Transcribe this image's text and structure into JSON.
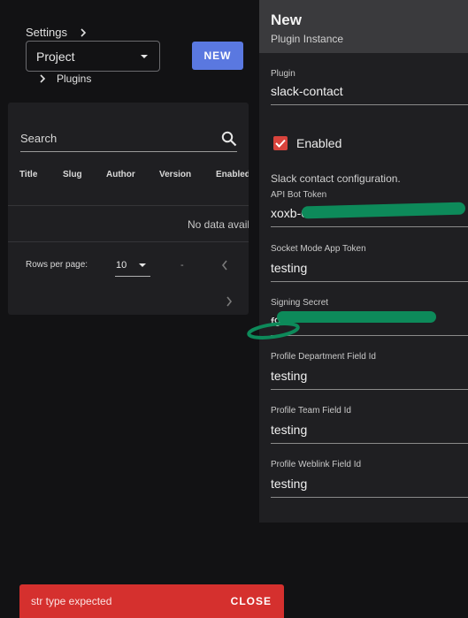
{
  "breadcrumb": {
    "settings": "Settings",
    "plugins": "Plugins"
  },
  "project_select": {
    "value": "Project"
  },
  "new_button": "NEW",
  "table": {
    "search_placeholder": "Search",
    "columns": [
      "Title",
      "Slug",
      "Author",
      "Version",
      "Enabled"
    ],
    "no_data": "No data avail",
    "rows_per_page_label": "Rows per page:",
    "rows_per_page_value": "10",
    "range": "-"
  },
  "drawer": {
    "title": "New",
    "subtitle": "Plugin Instance",
    "plugin_label": "Plugin",
    "plugin_value": "slack-contact",
    "enabled_label": "Enabled",
    "enabled_checked": true,
    "description": "Slack contact configuration.",
    "fields": [
      {
        "label": "API Bot Token",
        "value": "xoxb-0"
      },
      {
        "label": "Socket Mode App Token",
        "value": "testing"
      },
      {
        "label": "Signing Secret",
        "value": "f9"
      },
      {
        "label": "Profile Department Field Id",
        "value": "testing"
      },
      {
        "label": "Profile Team Field Id",
        "value": "testing"
      },
      {
        "label": "Profile Weblink Field Id",
        "value": "testing"
      }
    ]
  },
  "snackbar": {
    "message": "str type expected",
    "close_label": "CLOSE"
  },
  "colors": {
    "accent": "#5a78e0",
    "error": "#d5302e",
    "checkbox": "#d8433c",
    "redaction": "#0d8a5a"
  }
}
